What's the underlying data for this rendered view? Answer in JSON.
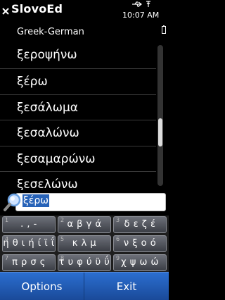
{
  "app": {
    "title": "SlovoEd",
    "dictionary": "Greek-German"
  },
  "status": {
    "time": "10:07 AM"
  },
  "words": [
    "ξεροψήνω",
    "ξέρω",
    "ξεσάλωμα",
    "ξεσαλώνω",
    "ξεσαμαρώνω",
    "ξεσελώνω"
  ],
  "search": {
    "value": "ξέρω"
  },
  "keypad": {
    "keys": [
      {
        "num": "1",
        "label": ". , -"
      },
      {
        "num": "2",
        "label": "α β γ ά"
      },
      {
        "num": "3",
        "label": "δ ε ζ έ"
      },
      {
        "num": "4",
        "label": "η θ ι ή ί ϊ ΐ"
      },
      {
        "num": "5",
        "label": "κ λ μ"
      },
      {
        "num": "6",
        "label": "ν ξ ο ό"
      },
      {
        "num": "7",
        "label": "π ρ σ ς"
      },
      {
        "num": "8",
        "label": "τ υ φ ύ ϋ ΰ"
      },
      {
        "num": "9",
        "label": "χ ψ ω ώ"
      }
    ]
  },
  "softkeys": {
    "left": "Options",
    "right": "Exit"
  },
  "colors": {
    "softkey_bar": "#2b6ed0",
    "selection": "#2863b8",
    "background": "#000000"
  }
}
